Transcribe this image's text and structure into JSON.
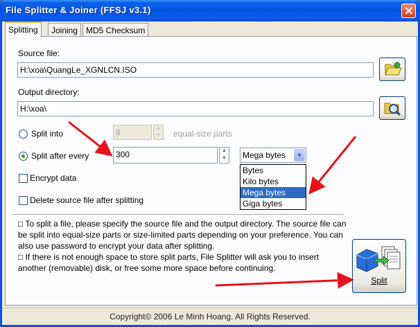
{
  "window": {
    "title": "File Splitter & Joiner (FFSJ v3.1)"
  },
  "tabs": [
    {
      "label": "Splitting",
      "active": true
    },
    {
      "label": "Joining",
      "active": false
    },
    {
      "label": "MD5 Checksum",
      "active": false
    }
  ],
  "source": {
    "label": "Source file:",
    "value": "H:\\xoa\\QuangLe_XGNLCN.ISO",
    "browse_icon": "folder-open-icon"
  },
  "output": {
    "label": "Output directory:",
    "value": "H:\\xoa\\",
    "browse_icon": "folder-search-icon"
  },
  "split_into": {
    "label": "Split into",
    "value": "8",
    "suffix": "equal-size parts",
    "checked": false
  },
  "split_after": {
    "label": "Split after every",
    "value": "300",
    "checked": true
  },
  "unit": {
    "selected": "Mega bytes",
    "options": [
      "Bytes",
      "Kilo bytes",
      "Mega bytes",
      "Giga bytes"
    ],
    "highlighted_index": 2
  },
  "encrypt": {
    "label": "Encrypt data",
    "checked": false
  },
  "delete_source": {
    "label": "Delete source file after splitting",
    "checked": false
  },
  "help": {
    "line1": "□ To split a file, please specify the source file and the output directory. The source file can be split into equal-size parts or size-limited parts depending on your preference. You can also use password to encrypt your data after splitting.",
    "line2": "□ If there is not enough space to store split parts, File Splitter will ask you to insert another (removable) disk, or free some more space before continuing."
  },
  "split_button": {
    "label": "Split"
  },
  "status": {
    "text": "Copyright© 2006 Le Minh Hoang. All Rights Reserved."
  },
  "colors": {
    "annotation_arrow": "#e8121c",
    "titlebar": "#0554e0",
    "selection": "#316ac5"
  }
}
